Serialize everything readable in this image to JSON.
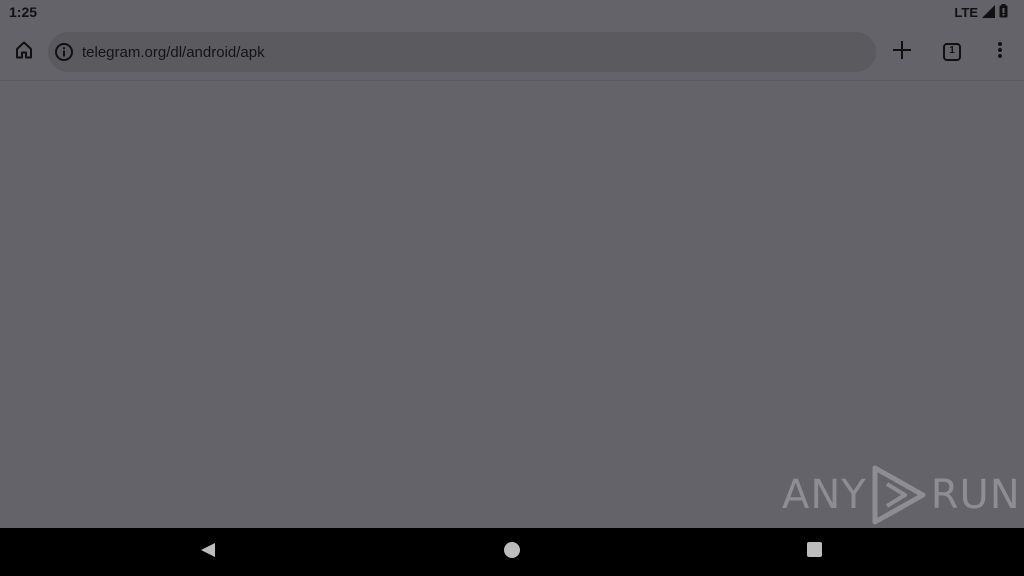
{
  "status_bar": {
    "time": "1:25",
    "network": "LTE"
  },
  "toolbar": {
    "url": "telegram.org/dl/android/apk",
    "tab_count": "1"
  },
  "watermark": {
    "left_text": "ANY",
    "right_text": "RUN"
  },
  "icons": {
    "home": "home-icon",
    "site_info": "info-icon",
    "new_tab": "plus-icon",
    "tabs": "tab-switcher-icon",
    "menu": "more-vert-icon",
    "signal": "signal-icon",
    "battery": "battery-icon",
    "back": "back-icon",
    "home_nav": "home-circle-icon",
    "recents": "recents-icon"
  },
  "colors": {
    "background": "#646369",
    "omnibox": "#5b5a5f",
    "nav_bar": "#000000",
    "watermark": "#8e8d93"
  }
}
